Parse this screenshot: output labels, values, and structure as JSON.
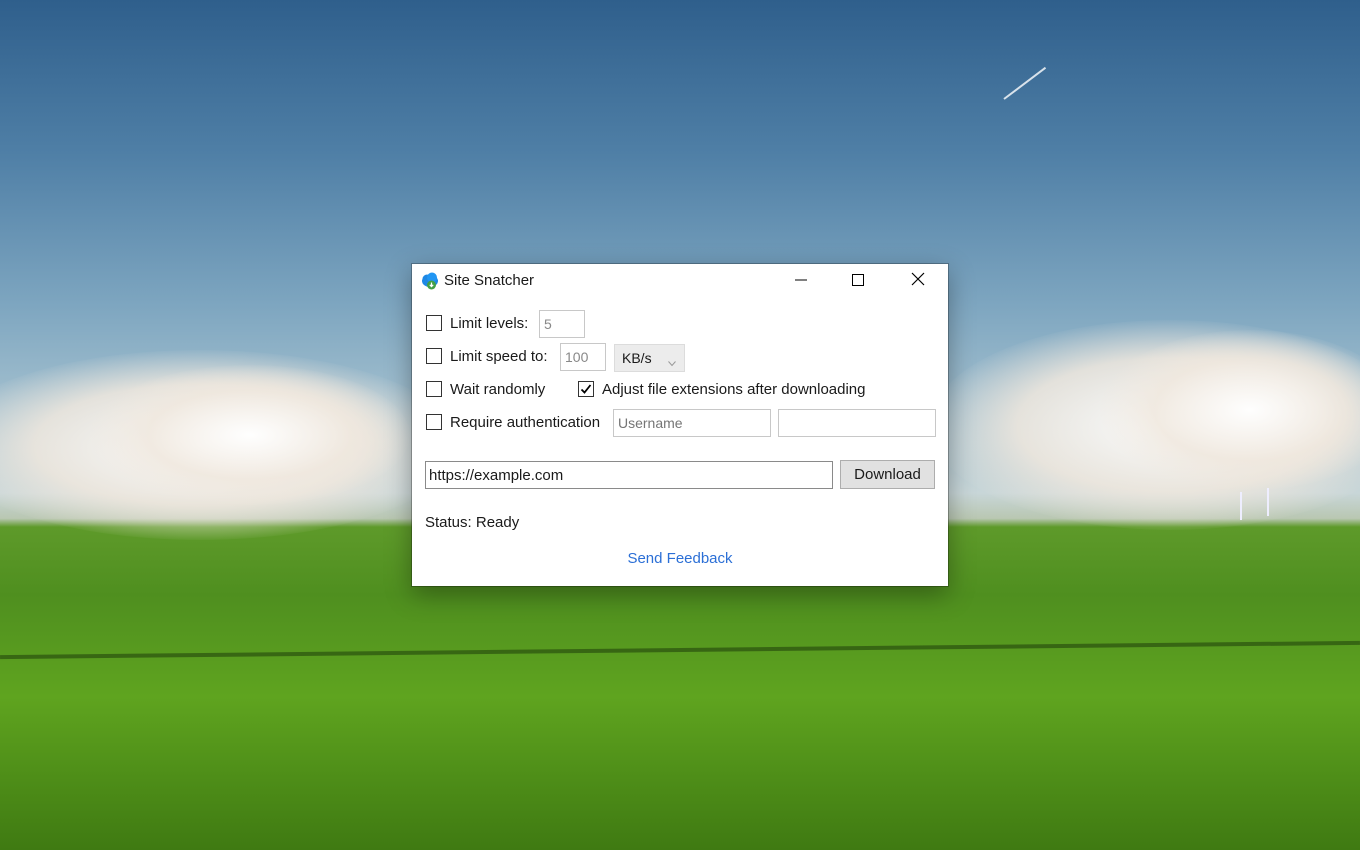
{
  "window": {
    "title": "Site Snatcher"
  },
  "options": {
    "limit_levels": {
      "label": "Limit levels:",
      "checked": false,
      "value": "5"
    },
    "limit_speed": {
      "label": "Limit speed to:",
      "checked": false,
      "value": "100",
      "unit": "KB/s"
    },
    "wait_randomly": {
      "label": "Wait randomly",
      "checked": false
    },
    "adjust_extensions": {
      "label": "Adjust file extensions after downloading",
      "checked": true
    },
    "require_auth": {
      "label": "Require authentication",
      "checked": false,
      "username_placeholder": "Username",
      "password_value": ""
    }
  },
  "url": {
    "value": "https://example.com"
  },
  "download_label": "Download",
  "status_text": "Status: Ready",
  "feedback_label": "Send Feedback",
  "colors": {
    "link": "#2b6fd6",
    "icon_cloud": "#1e88e5",
    "icon_badge": "#43a047"
  }
}
